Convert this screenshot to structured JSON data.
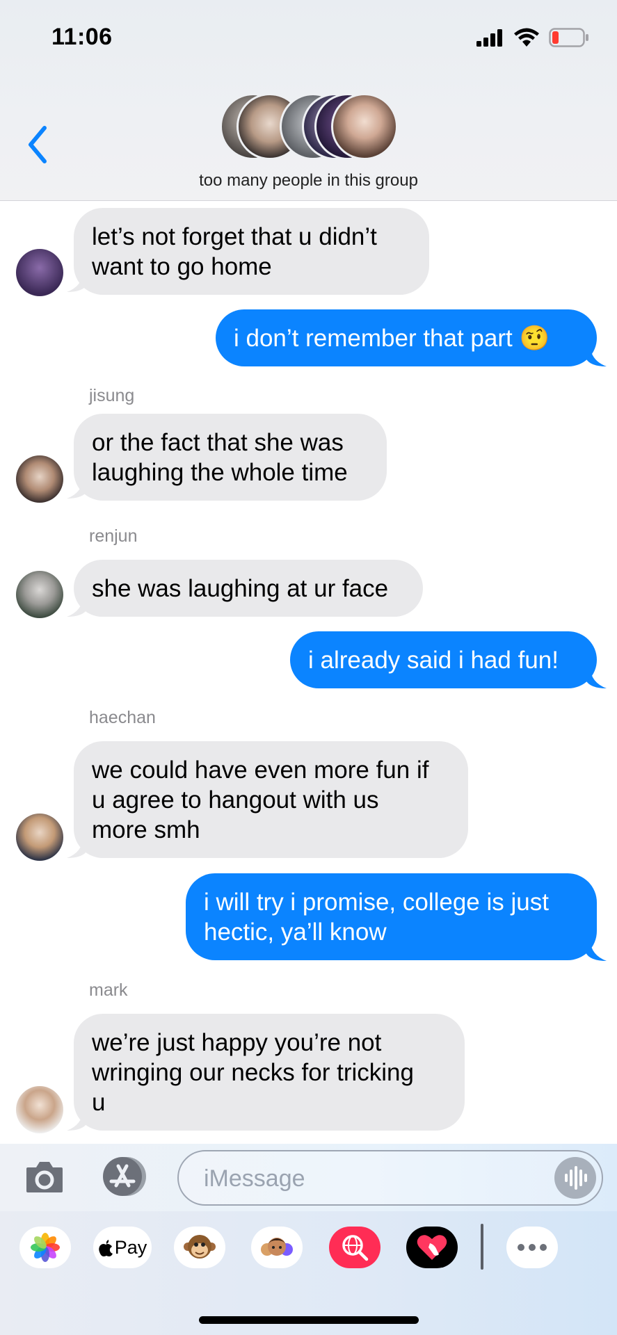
{
  "status": {
    "time": "11:06"
  },
  "header": {
    "group_name": "too many people in this group"
  },
  "messages": {
    "m1": {
      "text": "let’s not forget that u didn’t\nwant to go home"
    },
    "m2": {
      "text": "i don’t remember that part 🤨"
    },
    "m3": {
      "sender": "jisung",
      "text": "or the fact that she was\nlaughing the whole time"
    },
    "m4": {
      "sender": "renjun",
      "text": "she was laughing at ur face"
    },
    "m5": {
      "text": "i already said i had fun!"
    },
    "m6": {
      "sender": "haechan",
      "text": "we could have even more fun if\nu agree to hangout with us\nmore smh"
    },
    "m7": {
      "text": "i will try i promise, college is just\nhectic, ya’ll know"
    },
    "m8": {
      "sender": "mark",
      "text": "we’re just happy you’re not\nwringing our necks for tricking\nu"
    }
  },
  "compose": {
    "placeholder": "iMessage"
  },
  "drawer": {
    "apple_pay_label": "Pay"
  },
  "colors": {
    "outgoing_bubble": "#0b84ff",
    "incoming_bubble": "#e9e9eb",
    "accent": "#0b84ff"
  }
}
